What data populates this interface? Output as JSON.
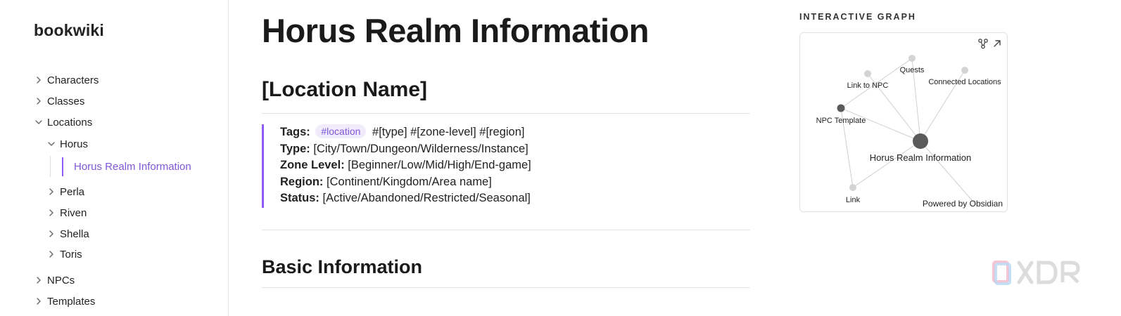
{
  "sidebar": {
    "site_title": "bookwiki",
    "items": {
      "characters": "Characters",
      "classes": "Classes",
      "locations": "Locations",
      "horus": "Horus",
      "horus_realm_info": "Horus Realm Information",
      "perla": "Perla",
      "riven": "Riven",
      "shella": "Shella",
      "toris": "Toris",
      "npcs": "NPCs",
      "templates": "Templates"
    }
  },
  "page": {
    "title": "Horus Realm Information",
    "section_location": "[Location Name]",
    "section_basic": "Basic Information",
    "properties": {
      "tags_label": "Tags:",
      "tag_location": "#location",
      "tags_rest": "#[type] #[zone-level] #[region]",
      "type_label": "Type:",
      "type_value": "[City/Town/Dungeon/Wilderness/Instance]",
      "zone_label": "Zone Level:",
      "zone_value": "[Beginner/Low/Mid/High/End-game]",
      "region_label": "Region:",
      "region_value": "[Continent/Kingdom/Area name]",
      "status_label": "Status:",
      "status_value": "[Active/Abandoned/Restricted/Seasonal]"
    }
  },
  "graph": {
    "heading": "INTERACTIVE GRAPH",
    "powered_by": "Powered by Obsidian",
    "nodes": {
      "quests": "Quests",
      "link_to_npc": "Link to NPC",
      "connected_locations": "Connected Locations",
      "npc_template": "NPC Template",
      "horus_realm_info": "Horus Realm Information",
      "link": "Link"
    },
    "icons": [
      "graph-settings-icon",
      "expand-icon"
    ]
  },
  "colors": {
    "accent": "#8b5cf6",
    "accent_text": "#7f56d9",
    "tag_bg": "#f1ecfc"
  },
  "watermark": "XDR"
}
